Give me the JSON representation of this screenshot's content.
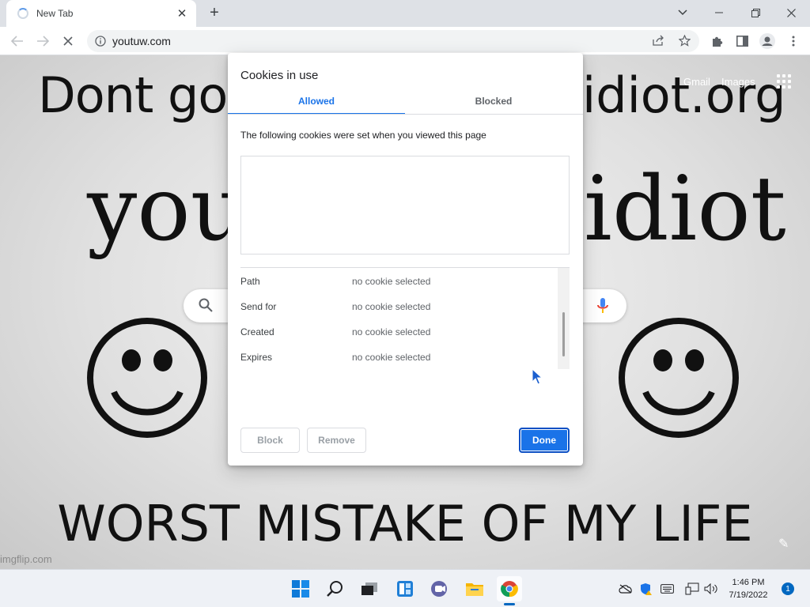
{
  "browser": {
    "tab_title": "New Tab",
    "tab_close": "✕",
    "new_tab": "+",
    "url": "youtuw.com",
    "window_controls": {
      "dropdown": "⌄",
      "minimize": "—",
      "restore": "❐",
      "close": "✕"
    }
  },
  "page": {
    "meme_top_left": "Dont go",
    "meme_top_right": "idiot.org",
    "meme_mid_left": "you",
    "meme_mid_right": "idiot",
    "meme_bottom": "WORST MISTAKE OF MY LIFE",
    "gmail_link": "Gmail",
    "images_link": "Images",
    "watermark": "imgflip.com"
  },
  "dialog": {
    "title": "Cookies in use",
    "tabs": [
      {
        "label": "Allowed",
        "active": true
      },
      {
        "label": "Blocked",
        "active": false
      }
    ],
    "description": "The following cookies were set when you viewed this page",
    "details": [
      {
        "label": "Path",
        "value": "no cookie selected"
      },
      {
        "label": "Send for",
        "value": "no cookie selected"
      },
      {
        "label": "Created",
        "value": "no cookie selected"
      },
      {
        "label": "Expires",
        "value": "no cookie selected"
      }
    ],
    "buttons": {
      "block": "Block",
      "remove": "Remove",
      "done": "Done"
    }
  },
  "taskbar": {
    "clock_time": "1:46 PM",
    "clock_date": "7/19/2022",
    "notification_count": "1"
  },
  "colors": {
    "accent": "#1a73e8",
    "windows_blue": "#0067c0"
  }
}
